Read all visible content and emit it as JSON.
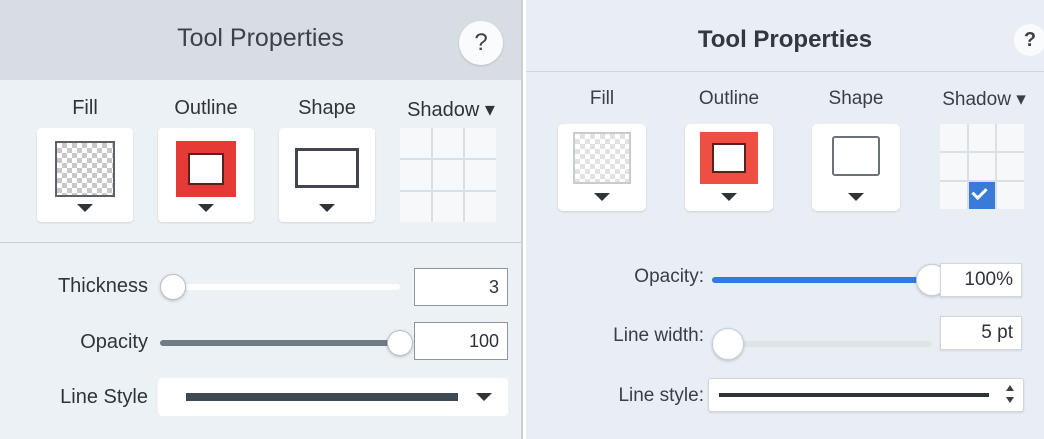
{
  "left_panel": {
    "title": "Tool Properties",
    "help_label": "?",
    "tools": [
      {
        "label": "Fill"
      },
      {
        "label": "Outline"
      },
      {
        "label": "Shape"
      },
      {
        "label": "Shadow ▾"
      }
    ],
    "thickness": {
      "label": "Thickness",
      "value": "3",
      "slider_fraction": 0.0
    },
    "opacity": {
      "label": "Opacity",
      "value": "100",
      "slider_fraction": 1.0
    },
    "line_style": {
      "label": "Line Style"
    },
    "colors": {
      "outline": "#e53a35",
      "slider_fill": "#6f7b86",
      "line": "#3d4a54"
    }
  },
  "right_panel": {
    "title": "Tool Properties",
    "help_label": "?",
    "tools": [
      {
        "label": "Fill"
      },
      {
        "label": "Outline"
      },
      {
        "label": "Shape"
      },
      {
        "label": "Shadow ▾"
      }
    ],
    "opacity": {
      "label": "Opacity:",
      "value": "100%",
      "slider_fraction": 1.0
    },
    "line_width": {
      "label": "Line width:",
      "value": "5 pt",
      "slider_fraction": 0.0
    },
    "line_style": {
      "label": "Line style:"
    },
    "colors": {
      "outline": "#ee4f42",
      "slider_fill": "#2f7ae5",
      "shadow_check": "#3a7bd8"
    }
  }
}
